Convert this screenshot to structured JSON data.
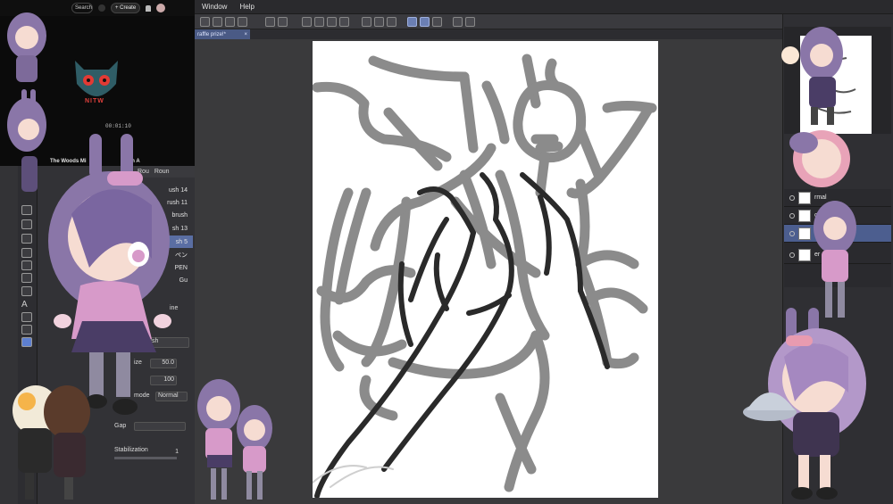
{
  "menu": {
    "window_label": "Window",
    "help_label": "Help"
  },
  "document_tab": {
    "title": "raffle prize!*",
    "close": "×"
  },
  "video": {
    "search_label": "Search",
    "create_label": "+ Create",
    "title": "The Woods Mi",
    "title_suffix": "umn A",
    "logo_text": "NITW",
    "time": "00:01:10"
  },
  "brush_tabs": [
    {
      "label": "Rou"
    },
    {
      "label": "Roun"
    }
  ],
  "brush_list": [
    {
      "label": "ush 14"
    },
    {
      "label": "rush 11"
    },
    {
      "label": "brush"
    },
    {
      "label": "sh 13"
    },
    {
      "label": "sh 5"
    },
    {
      "label": "ペン"
    },
    {
      "label": "PEN"
    },
    {
      "label": "Gu"
    }
  ],
  "tool_property": {
    "current_brush": "g brush",
    "size_label": "ize",
    "size_value": "50.0",
    "opacity_value": "100",
    "blend_label": "mode",
    "blend_value": "Normal",
    "gap_label": "Gap",
    "stabilization_label": "Stabilization",
    "stabilization_value": "1",
    "line_label": "ine"
  },
  "layers": [
    {
      "name": "rmal",
      "selected": false
    },
    {
      "name": "ormal",
      "selected": false
    },
    {
      "name": "mal",
      "selected": true
    },
    {
      "name": "er",
      "selected": false
    }
  ],
  "colors": {
    "accent": "#6b7fb3",
    "selected_layer": "#4c5e8f",
    "nitw_red": "#e0403c",
    "character_purple": "#8a76a8",
    "character_pink": "#d79ac9"
  },
  "icons": {
    "menu_icons": [
      "new-file-icon",
      "open-icon",
      "save-icon",
      "undo-icon",
      "redo-icon",
      "transform-icon",
      "brush-icon",
      "eraser-icon",
      "settings-icon"
    ],
    "tool_icons": [
      "checker-icon",
      "pen-icon",
      "fill-icon",
      "layer-icon",
      "rect-icon",
      "frame-icon",
      "figure-icon",
      "text-icon",
      "lasso-icon",
      "pointer-icon",
      "color-icon"
    ]
  }
}
